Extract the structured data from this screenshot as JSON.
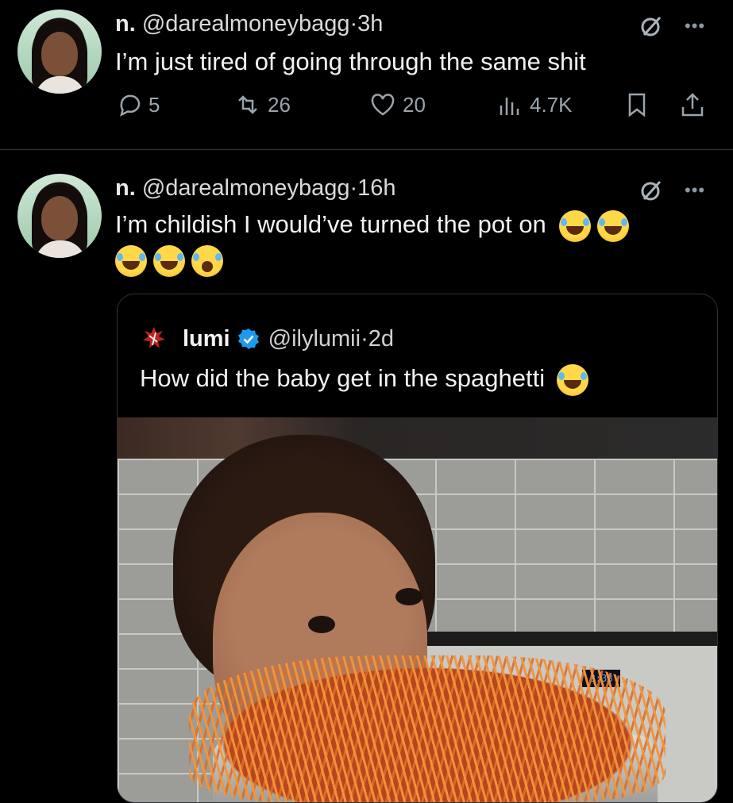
{
  "tweets": [
    {
      "name": "n.",
      "handle": "@darealmoneybagg",
      "sep": "·",
      "time": "3h",
      "text": "I’m just tired of going through the same shit",
      "actions": {
        "replies": "5",
        "reposts": "26",
        "likes": "20",
        "views": "4.7K"
      }
    },
    {
      "name": "n.",
      "handle": "@darealmoneybagg",
      "sep": "·",
      "time": "16h",
      "text": "I’m childish I would’ve turned the pot on",
      "emojis": [
        "face-with-tears-of-joy",
        "face-with-tears-of-joy",
        "face-with-tears-of-joy",
        "face-with-tears-of-joy",
        "loudly-crying-face"
      ],
      "quote": {
        "name": "lumi",
        "handle": "@ilylumii",
        "sep": "·",
        "time": "2d",
        "text": "How did the baby get in the spaghetti",
        "emoji": "face-with-tears-of-joy",
        "verified_color": "#1d9bf0",
        "media": {
          "stove_display": "8:38"
        }
      }
    }
  ],
  "icons": {
    "grok": "grok-icon",
    "more": "more-icon",
    "reply": "reply-icon",
    "repost": "repost-icon",
    "like": "heart-icon",
    "views": "views-icon",
    "bookmark": "bookmark-icon",
    "share": "share-icon"
  }
}
